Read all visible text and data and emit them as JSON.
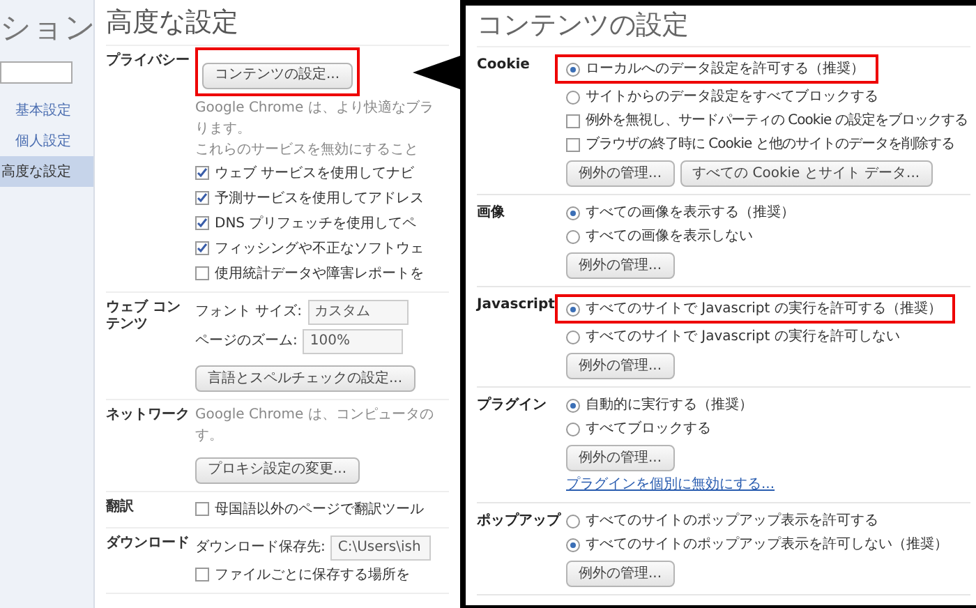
{
  "sidebar": {
    "title": "ション",
    "items": [
      {
        "label": "基本設定",
        "selected": false
      },
      {
        "label": "個人設定",
        "selected": false
      },
      {
        "label": "高度な設定",
        "selected": true
      }
    ]
  },
  "main": {
    "title": "高度な設定",
    "sections": [
      {
        "label": "プライバシー",
        "items": [
          {
            "kind": "button",
            "label": "コンテンツの設定...",
            "highlighted": true
          },
          {
            "kind": "text",
            "text": "Google Chrome は、より快適なブラ"
          },
          {
            "kind": "text",
            "text": "ります。"
          },
          {
            "kind": "text",
            "text": "これらのサービスを無効にすること"
          },
          {
            "kind": "checkbox",
            "label": "ウェブ サービスを使用してナビ",
            "checked": true
          },
          {
            "kind": "checkbox",
            "label": "予測サービスを使用してアドレス",
            "checked": true
          },
          {
            "kind": "checkbox",
            "label": "DNS プリフェッチを使用してペ",
            "checked": true
          },
          {
            "kind": "checkbox",
            "label": "フィッシングや不正なソフトウェ",
            "checked": true
          },
          {
            "kind": "checkbox",
            "label": "使用統計データや障害レポートを",
            "checked": false
          }
        ]
      },
      {
        "label": "ウェブ コンテンツ",
        "items": [
          {
            "kind": "select",
            "label": "フォント サイズ:",
            "value": "カスタム"
          },
          {
            "kind": "select",
            "label": "ページのズーム:",
            "value": "100%"
          },
          {
            "kind": "button",
            "label": "言語とスペルチェックの設定...",
            "highlighted": false
          }
        ]
      },
      {
        "label": "ネットワーク",
        "items": [
          {
            "kind": "text",
            "text": "Google Chrome は、コンピュータの"
          },
          {
            "kind": "text",
            "text": "す。"
          },
          {
            "kind": "button",
            "label": "プロキシ設定の変更...",
            "highlighted": false
          }
        ]
      },
      {
        "label": "翻訳",
        "items": [
          {
            "kind": "checkbox",
            "label": "母国語以外のページで翻訳ツール",
            "checked": false
          }
        ]
      },
      {
        "label": "ダウンロード",
        "items": [
          {
            "kind": "select",
            "label": "ダウンロード保存先:",
            "value": "C:\\Users\\ish"
          },
          {
            "kind": "checkbox",
            "label": "ファイルごとに保存する場所を",
            "checked": false
          }
        ]
      }
    ]
  },
  "panel": {
    "title": "コンテンツの設定",
    "sections": [
      {
        "label": "Cookie",
        "items": [
          {
            "kind": "radio",
            "label": "ローカルへのデータ設定を許可する（推奨）",
            "selected": true,
            "highlighted": true
          },
          {
            "kind": "radio",
            "label": "サイトからのデータ設定をすべてブロックする",
            "selected": false,
            "highlighted": false
          },
          {
            "kind": "checkbox",
            "label": "例外を無視し、サードパーティの Cookie の設定をブロックする",
            "checked": false
          },
          {
            "kind": "checkbox",
            "label": "ブラウザの終了時に Cookie と他のサイトのデータを削除する",
            "checked": false
          },
          {
            "kind": "buttons",
            "buttons": [
              "例外の管理...",
              "すべての Cookie とサイト データ..."
            ]
          }
        ]
      },
      {
        "label": "画像",
        "items": [
          {
            "kind": "radio",
            "label": "すべての画像を表示する（推奨）",
            "selected": true,
            "highlighted": false
          },
          {
            "kind": "radio",
            "label": "すべての画像を表示しない",
            "selected": false,
            "highlighted": false
          },
          {
            "kind": "buttons",
            "buttons": [
              "例外の管理..."
            ]
          }
        ]
      },
      {
        "label": "Javascript",
        "items": [
          {
            "kind": "radio",
            "label": "すべてのサイトで Javascript の実行を許可する（推奨）",
            "selected": true,
            "highlighted": true
          },
          {
            "kind": "radio",
            "label": "すべてのサイトで Javascript の実行を許可しない",
            "selected": false,
            "highlighted": false
          },
          {
            "kind": "buttons",
            "buttons": [
              "例外の管理..."
            ]
          }
        ]
      },
      {
        "label": "プラグイン",
        "items": [
          {
            "kind": "radio",
            "label": "自動的に実行する（推奨）",
            "selected": true,
            "highlighted": false
          },
          {
            "kind": "radio",
            "label": "すべてブロックする",
            "selected": false,
            "highlighted": false
          },
          {
            "kind": "buttons",
            "buttons": [
              "例外の管理..."
            ]
          },
          {
            "kind": "link",
            "label": "プラグインを個別に無効にする..."
          }
        ]
      },
      {
        "label": "ポップアップ",
        "items": [
          {
            "kind": "radio",
            "label": "すべてのサイトのポップアップ表示を許可する",
            "selected": false,
            "highlighted": false
          },
          {
            "kind": "radio",
            "label": "すべてのサイトのポップアップ表示を許可しない（推奨）",
            "selected": true,
            "highlighted": false
          },
          {
            "kind": "buttons",
            "buttons": [
              "例外の管理..."
            ]
          }
        ]
      }
    ]
  }
}
